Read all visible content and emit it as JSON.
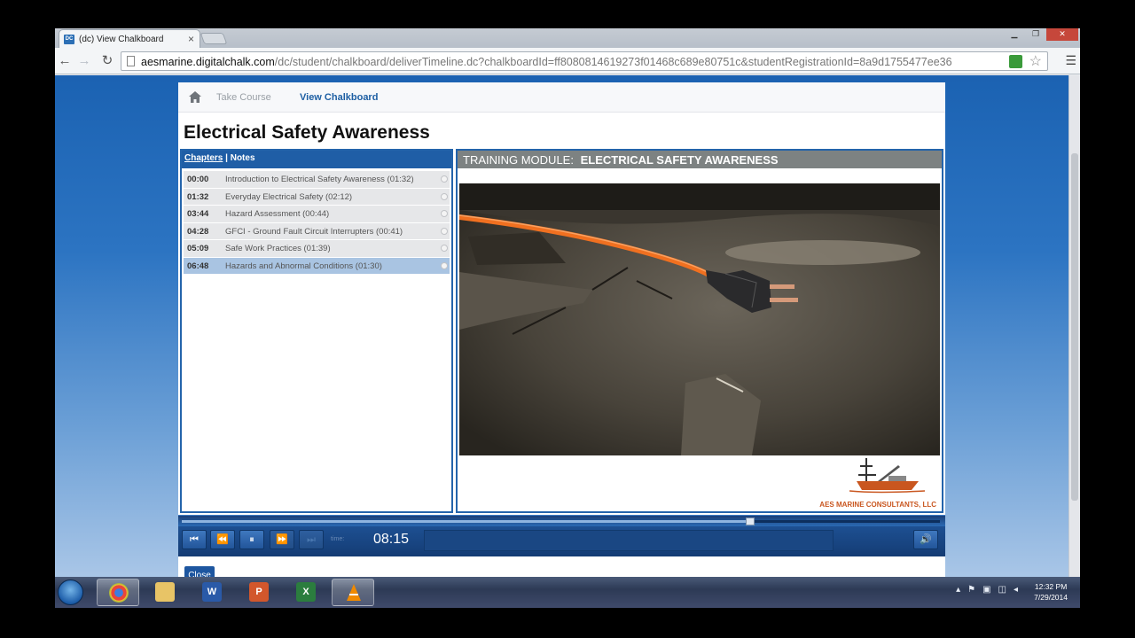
{
  "browser": {
    "tab_title": "(dc) View Chalkboard",
    "tab_favicon": "DC",
    "tab_close": "×",
    "url_domain": "aesmarine.digitalchalk.com",
    "url_path": "/dc/student/chalkboard/deliverTimeline.dc?chalkboardId=ff8080814619273f01468c689e80751c&studentRegistrationId=8a9d1755477ee36"
  },
  "breadcrumb": {
    "items": [
      "Take Course",
      "View Chalkboard"
    ]
  },
  "page": {
    "title": "Electrical Safety Awareness"
  },
  "chapters": {
    "tab_chapters": "Chapters",
    "separator": " | ",
    "tab_notes": "Notes",
    "items": [
      {
        "time": "00:00",
        "name": "Introduction to Electrical Safety Awareness (01:32)"
      },
      {
        "time": "01:32",
        "name": "Everyday Electrical Safety (02:12)"
      },
      {
        "time": "03:44",
        "name": "Hazard Assessment (00:44)"
      },
      {
        "time": "04:28",
        "name": "GFCI - Ground Fault Circuit Interrupters (00:41)"
      },
      {
        "time": "05:09",
        "name": "Safe Work Practices (01:39)"
      },
      {
        "time": "06:48",
        "name": "Hazards and Abnormal Conditions (01:30)"
      }
    ],
    "current_index": 5
  },
  "module": {
    "label": "TRAINING MODULE:",
    "name": "ELECTRICAL SAFETY AWARENESS",
    "logo_text": "AES MARINE CONSULTANTS, LLC"
  },
  "player": {
    "time_label": "time:",
    "current_time": "08:15",
    "progress_fraction": 0.75,
    "buttons": {
      "first": "⏮",
      "rewind": "⏪",
      "pause": "⏸",
      "forward": "⏩",
      "last": "⏭",
      "volume": "🔊"
    }
  },
  "close_button": "Close",
  "taskbar": {
    "time": "12:32 PM",
    "date": "7/29/2014",
    "apps": [
      "chrome-icon",
      "explorer-icon",
      "word-icon",
      "powerpoint-icon",
      "excel-icon",
      "vlc-icon"
    ]
  },
  "colors": {
    "brand_blue": "#1f5ea6",
    "module_header": "#7d8282",
    "highlight_row": "#a9c4e2",
    "cord_orange": "#f07020"
  }
}
